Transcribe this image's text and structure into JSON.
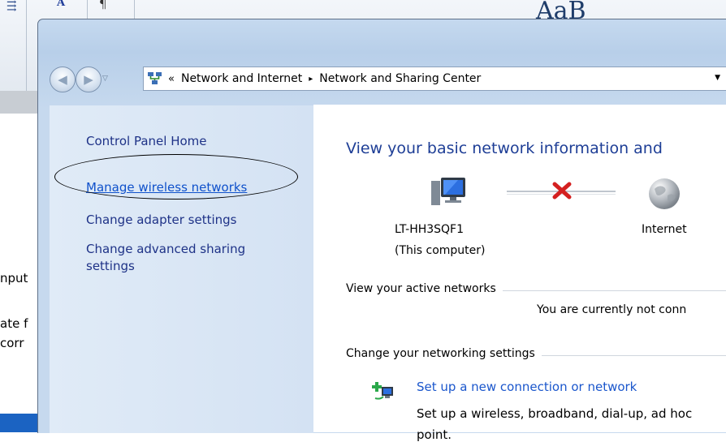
{
  "background_app": {
    "glyph_a": "A",
    "glyph_pilcrow": "¶",
    "styles_preview": "AaB",
    "text_fragment_1": "nput",
    "text_fragment_2": "ate f",
    "text_fragment_3": "corr"
  },
  "navigation": {
    "back_icon": "back-arrow",
    "forward_icon": "forward-arrow",
    "address_chevron": "«",
    "breadcrumb": [
      "Network and Internet",
      "Network and Sharing Center"
    ],
    "separator": "▸"
  },
  "left_pane": {
    "items": [
      {
        "label": "Control Panel Home",
        "link": false
      },
      {
        "label": "Manage wireless networks",
        "link": true
      },
      {
        "label": "Change adapter settings",
        "link": false
      },
      {
        "label": "Change advanced sharing",
        "link": false
      },
      {
        "label": "settings",
        "link": false
      }
    ]
  },
  "main": {
    "title": "View your basic network information and",
    "computer_name": "LT-HH3SQF1",
    "computer_caption": "(This computer)",
    "internet_label": "Internet",
    "active_networks_heading": "View your active networks",
    "not_connected_text": "You are currently not conn",
    "change_settings_heading": "Change your networking settings",
    "task_link": "Set up a new connection or network",
    "task_desc": "Set up a wireless, broadband, dial-up, ad hoc",
    "task_desc2": "point."
  },
  "colors": {
    "link": "#0f51cb",
    "title": "#1e3e96",
    "left_pane_bg": "#d9e6f5",
    "error_x": "#d42020"
  }
}
